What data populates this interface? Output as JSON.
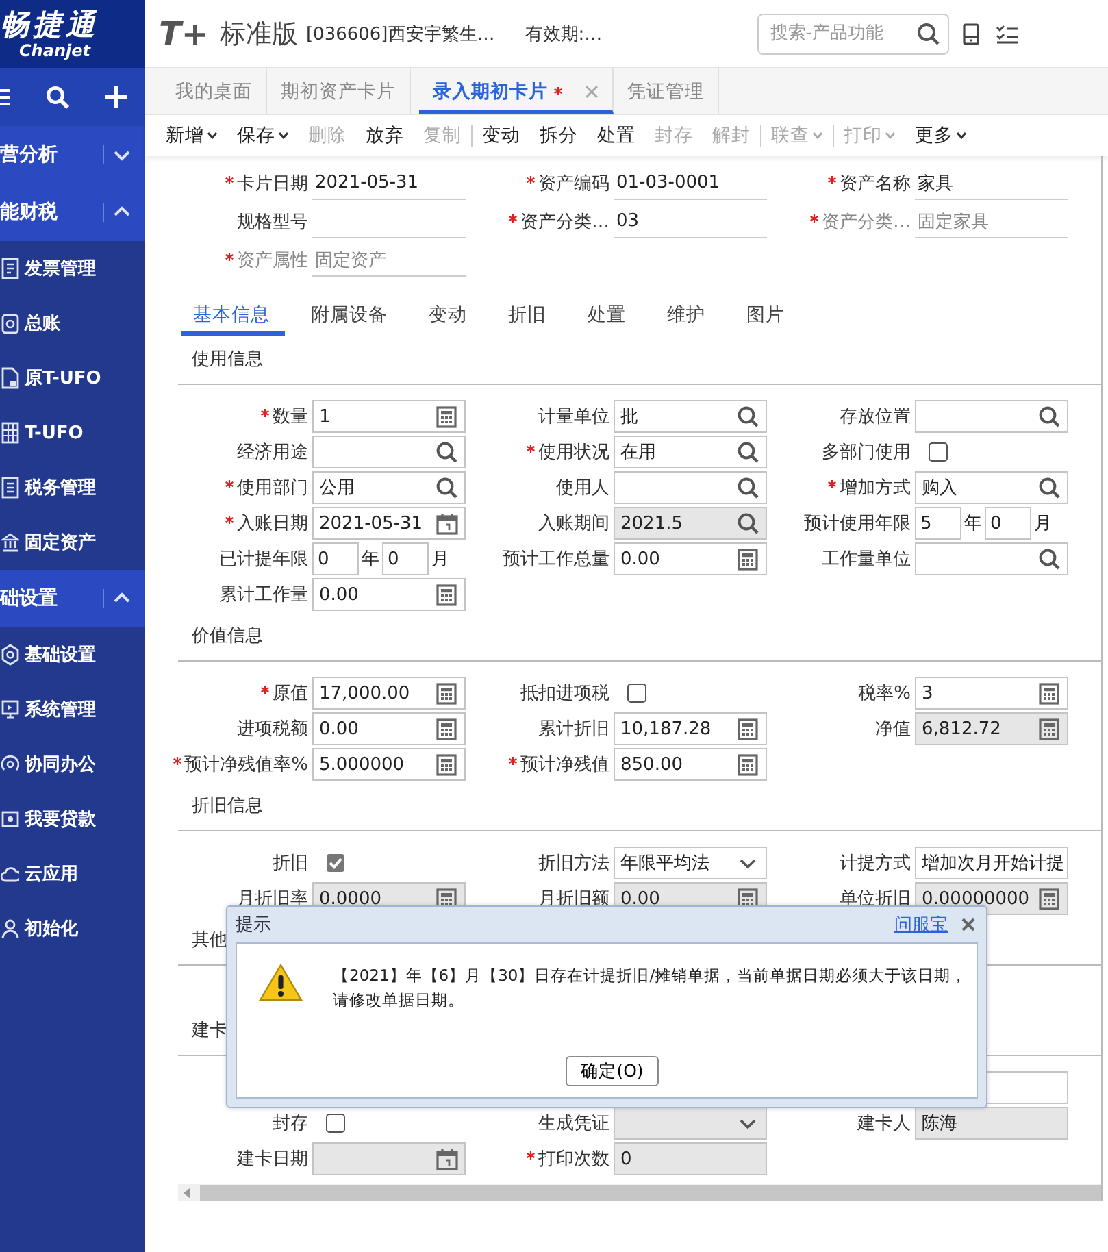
{
  "sidebar": {
    "logo": {
      "name": "畅捷通",
      "latin": "Chanjet"
    },
    "groups": [
      {
        "title": "营分析",
        "expanded": false
      },
      {
        "title": "能财税",
        "expanded": true,
        "items": [
          {
            "label": "发票管理"
          },
          {
            "label": "总账"
          },
          {
            "label": "原T-UFO"
          },
          {
            "label": "T-UFO"
          },
          {
            "label": "税务管理"
          },
          {
            "label": "固定资产"
          }
        ]
      },
      {
        "title": "础设置",
        "expanded": true,
        "items": [
          {
            "label": "基础设置"
          },
          {
            "label": "系统管理"
          },
          {
            "label": "协同办公"
          },
          {
            "label": "我要贷款"
          },
          {
            "label": "云应用"
          },
          {
            "label": "初始化"
          }
        ]
      }
    ]
  },
  "header": {
    "logo": "T+",
    "product": "标准版",
    "company": "[036606]西安宇繁生…",
    "validity": "有效期:…",
    "search": {
      "placeholder": "搜索-产品功能"
    }
  },
  "tabs": [
    {
      "label": "我的桌面",
      "selected": false,
      "modified": false,
      "closable": false
    },
    {
      "label": "期初资产卡片",
      "selected": false,
      "modified": false,
      "closable": false
    },
    {
      "label": "录入期初卡片",
      "selected": true,
      "modified": true,
      "closable": true
    },
    {
      "label": "凭证管理",
      "selected": false,
      "modified": false,
      "closable": false
    }
  ],
  "toolbar": [
    {
      "kind": "button",
      "label": "新增",
      "menu": true,
      "disabled": false
    },
    {
      "kind": "button",
      "label": "保存",
      "menu": true,
      "disabled": false
    },
    {
      "kind": "button",
      "label": "删除",
      "menu": false,
      "disabled": true
    },
    {
      "kind": "button",
      "label": "放弃",
      "menu": false,
      "disabled": false
    },
    {
      "kind": "button",
      "label": "复制",
      "menu": false,
      "disabled": true
    },
    {
      "kind": "separator"
    },
    {
      "kind": "button",
      "label": "变动",
      "menu": false,
      "disabled": false
    },
    {
      "kind": "button",
      "label": "拆分",
      "menu": false,
      "disabled": false
    },
    {
      "kind": "button",
      "label": "处置",
      "menu": false,
      "disabled": false
    },
    {
      "kind": "button",
      "label": "封存",
      "menu": false,
      "disabled": true
    },
    {
      "kind": "button",
      "label": "解封",
      "menu": false,
      "disabled": true
    },
    {
      "kind": "separator"
    },
    {
      "kind": "button",
      "label": "联查",
      "menu": true,
      "disabled": true
    },
    {
      "kind": "separator"
    },
    {
      "kind": "button",
      "label": "打印",
      "menu": true,
      "disabled": true
    },
    {
      "kind": "button",
      "label": "更多",
      "menu": true,
      "disabled": false
    }
  ],
  "card_header": [
    [
      {
        "label": "卡片日期",
        "required": true,
        "value": "2021-05-31",
        "disabled": false
      },
      {
        "label": "资产编码",
        "required": true,
        "value": "01-03-0001",
        "disabled": false
      },
      {
        "label": "资产名称",
        "required": true,
        "value": "家具",
        "disabled": false
      }
    ],
    [
      {
        "label": "规格型号",
        "required": false
      },
      {
        "label": "资产分类…",
        "required": true,
        "value": "03",
        "disabled": false
      },
      {
        "label": "资产分类…",
        "required": true,
        "value": "固定家具",
        "disabled": true
      }
    ],
    [
      {
        "label": "资产属性",
        "required": true,
        "value": "固定资产",
        "disabled": true
      }
    ]
  ],
  "subtabs": [
    {
      "label": "基本信息",
      "selected": true
    },
    {
      "label": "附属设备",
      "selected": false
    },
    {
      "label": "变动",
      "selected": false
    },
    {
      "label": "折旧",
      "selected": false
    },
    {
      "label": "处置",
      "selected": false
    },
    {
      "label": "维护",
      "selected": false
    },
    {
      "label": "图片",
      "selected": false
    }
  ],
  "sections": [
    {
      "title": "使用信息",
      "rows": [
        [
          {
            "label": "数量",
            "required": true,
            "kind": "calc",
            "value": "1",
            "disabled": false
          },
          {
            "label": "计量单位",
            "required": false,
            "kind": "lookup",
            "value": "批",
            "disabled": false
          },
          {
            "label": "存放位置",
            "required": false,
            "kind": "lookup",
            "disabled": false
          }
        ],
        [
          {
            "label": "经济用途",
            "required": false,
            "kind": "lookup",
            "disabled": false
          },
          {
            "label": "使用状况",
            "required": true,
            "kind": "lookup",
            "value": "在用",
            "disabled": false
          },
          {
            "label": "多部门使用",
            "required": false,
            "kind": "check",
            "checked": false
          }
        ],
        [
          {
            "label": "使用部门",
            "required": true,
            "kind": "lookup",
            "value": "公用",
            "disabled": false
          },
          {
            "label": "使用人",
            "required": false,
            "kind": "lookup",
            "disabled": false
          },
          {
            "label": "增加方式",
            "required": true,
            "kind": "lookup",
            "value": "购入",
            "disabled": false
          }
        ],
        [
          {
            "label": "入账日期",
            "required": true,
            "kind": "date",
            "value": "2021-05-31",
            "disabled": false
          },
          {
            "label": "入账期间",
            "required": false,
            "kind": "lookup",
            "value": "2021.5",
            "disabled": true
          },
          {
            "label": "预计使用年限",
            "required": false,
            "kind": "duration",
            "parts": [
              {
                "value": "5",
                "unit": "年"
              },
              {
                "value": "0",
                "unit": "月"
              }
            ]
          }
        ],
        [
          {
            "label": "已计提年限",
            "required": false,
            "kind": "duration",
            "parts": [
              {
                "value": "0",
                "unit": "年"
              },
              {
                "value": "0",
                "unit": "月"
              }
            ]
          },
          {
            "label": "预计工作总量",
            "required": false,
            "kind": "calc",
            "value": "0.00",
            "disabled": false
          },
          {
            "label": "工作量单位",
            "required": false,
            "kind": "lookup",
            "disabled": false
          }
        ],
        [
          {
            "label": "累计工作量",
            "required": false,
            "kind": "calc",
            "value": "0.00",
            "disabled": false
          }
        ]
      ]
    },
    {
      "title": "价值信息",
      "rows": [
        [
          {
            "label": "原值",
            "required": true,
            "kind": "calc",
            "value": "17,000.00",
            "disabled": false
          },
          {
            "label": "抵扣进项税",
            "required": false,
            "kind": "check",
            "checked": false
          },
          {
            "label": "税率%",
            "required": false,
            "kind": "calc",
            "value": "3",
            "disabled": false
          }
        ],
        [
          {
            "label": "进项税额",
            "required": false,
            "kind": "calc",
            "value": "0.00",
            "disabled": false
          },
          {
            "label": "累计折旧",
            "required": false,
            "kind": "calc",
            "value": "10,187.28",
            "disabled": false
          },
          {
            "label": "净值",
            "required": false,
            "kind": "calc",
            "value": "6,812.72",
            "disabled": true
          }
        ],
        [
          {
            "label": "预计净残值率%",
            "required": true,
            "kind": "calc",
            "value": "5.000000",
            "disabled": false
          },
          {
            "label": "预计净残值",
            "required": true,
            "kind": "calc",
            "value": "850.00",
            "disabled": false
          }
        ]
      ]
    },
    {
      "title": "折旧信息",
      "rows": [
        [
          {
            "label": "折旧",
            "required": false,
            "kind": "check",
            "checked": true
          },
          {
            "label": "折旧方法",
            "required": false,
            "kind": "select",
            "value": "年限平均法",
            "disabled": false
          },
          {
            "label": "计提方式",
            "required": false,
            "kind": "text",
            "value": "增加次月开始计提",
            "disabled": false
          }
        ],
        [
          {
            "label": "月折旧率",
            "required": false,
            "kind": "calc",
            "value": "0.0000",
            "disabled": true
          },
          {
            "label": "月折旧额",
            "required": false,
            "kind": "calc",
            "value": "0.00",
            "disabled": true
          },
          {
            "label": "单位折旧",
            "required": false,
            "kind": "calc",
            "value": "0.00000000",
            "disabled": true
          }
        ]
      ]
    },
    {
      "title": "其他"
    },
    {
      "title": "建卡",
      "rows": [
        [
          {
            "kind": "blank"
          },
          {
            "kind": "blank"
          },
          {
            "kind": "text",
            "disabled": false
          }
        ],
        [
          {
            "label": "封存",
            "required": false,
            "kind": "check",
            "checked": false
          },
          {
            "label": "生成凭证",
            "required": false,
            "kind": "select",
            "disabled": true
          },
          {
            "label": "建卡人",
            "required": false,
            "kind": "text",
            "value": "陈海",
            "disabled": true
          }
        ],
        [
          {
            "label": "建卡日期",
            "required": false,
            "kind": "date",
            "disabled": true
          },
          {
            "label": "打印次数",
            "required": true,
            "kind": "text",
            "value": "0",
            "disabled": true
          }
        ]
      ]
    }
  ],
  "dialog": {
    "title": "提示",
    "link": "问服宝",
    "message": "【2021】年【6】月【30】日存在计提折旧/摊销单据，当前单据日期必须大于该日期，请修改单据日期。",
    "button": "确定(O)"
  }
}
